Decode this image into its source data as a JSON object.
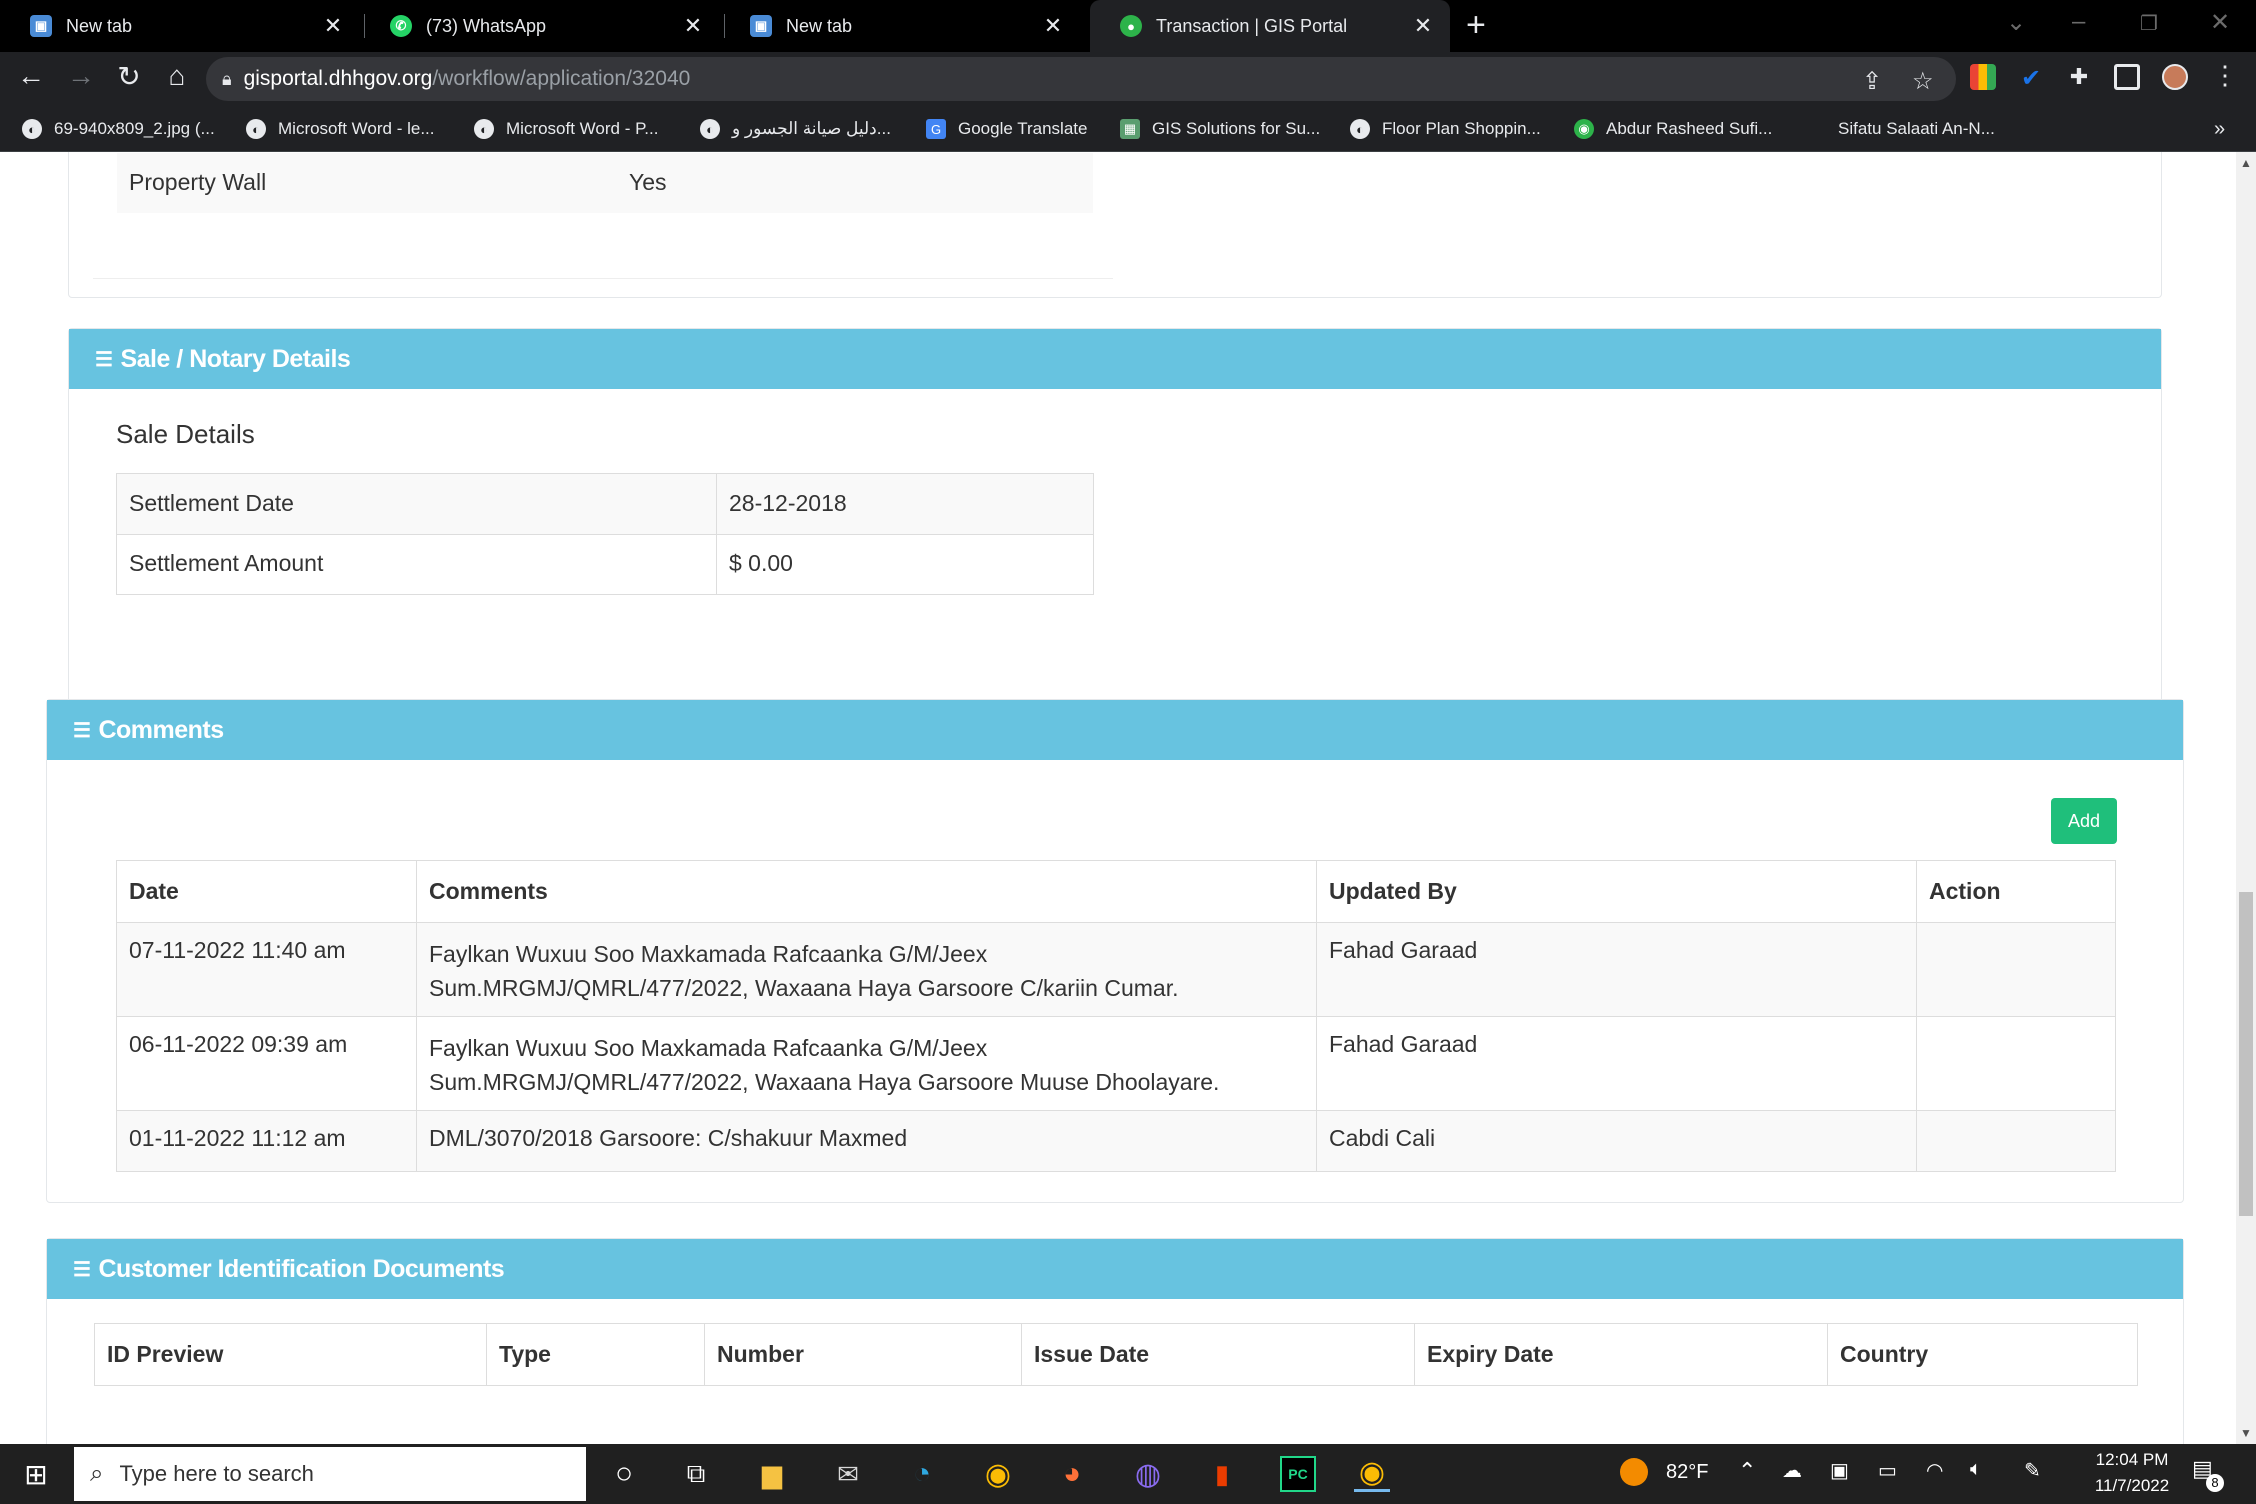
{
  "browser": {
    "tabs": [
      {
        "title": "New tab",
        "active": false
      },
      {
        "title": "(73) WhatsApp",
        "active": false
      },
      {
        "title": "New tab",
        "active": false
      },
      {
        "title": "Transaction | GIS Portal",
        "active": true
      }
    ],
    "close_glyph": "✕",
    "new_tab_glyph": "+",
    "url_host": "gisportal.dhhgov.org",
    "url_path": "/workflow/application/32040",
    "bookmarks": [
      "69-940x809_2.jpg (...",
      "Microsoft Word - le...",
      "Microsoft Word - P...",
      "دليل صيانة الجسور و...",
      "Google Translate",
      "GIS Solutions for Su...",
      "Floor Plan Shoppin...",
      "Abdur Rasheed Sufi...",
      "Sifatu Salaati An-N..."
    ],
    "bookmarks_overflow": "»"
  },
  "property": {
    "rows": [
      {
        "label": "Property Wall",
        "value": "Yes"
      }
    ]
  },
  "sale": {
    "heading": "Sale / Notary Details",
    "subheading": "Sale Details",
    "rows": [
      {
        "label": "Settlement Date",
        "value": "28-12-2018"
      },
      {
        "label": "Settlement Amount",
        "value": "$ 0.00"
      }
    ]
  },
  "comments": {
    "heading": "Comments",
    "add_label": "Add",
    "columns": [
      "Date",
      "Comments",
      "Updated By",
      "Action"
    ],
    "rows": [
      {
        "date": "07-11-2022 11:40 am",
        "comment_line1": "Faylkan Wuxuu Soo Maxkamada Rafcaanka G/M/Jeex",
        "comment_line2": "Sum.MRGMJ/QMRL/477/2022, Waxaana Haya Garsoore C/kariin Cumar.",
        "updated_by": "Fahad Garaad",
        "action": ""
      },
      {
        "date": "06-11-2022 09:39 am",
        "comment_line1": "Faylkan Wuxuu Soo Maxkamada Rafcaanka G/M/Jeex",
        "comment_line2": "Sum.MRGMJ/QMRL/477/2022, Waxaana Haya Garsoore Muuse Dhoolayare.",
        "updated_by": "Fahad Garaad",
        "action": ""
      },
      {
        "date": "01-11-2022 11:12 am",
        "comment_line1": "DML/3070/2018 Garsoore: C/shakuur Maxmed",
        "comment_line2": "",
        "updated_by": "Cabdi Cali",
        "action": ""
      }
    ]
  },
  "id_docs": {
    "heading": "Customer Identification Documents",
    "columns": [
      "ID Preview",
      "Type",
      "Number",
      "Issue Date",
      "Expiry Date",
      "Country"
    ]
  },
  "taskbar": {
    "search_placeholder": "Type here to search",
    "temperature": "82°F",
    "time": "12:04 PM",
    "date": "11/7/2022",
    "notification_count": "8"
  },
  "colors": {
    "panel_header": "#67c3e0",
    "add_button": "#1fbf7b",
    "chrome_dark": "#202124"
  }
}
